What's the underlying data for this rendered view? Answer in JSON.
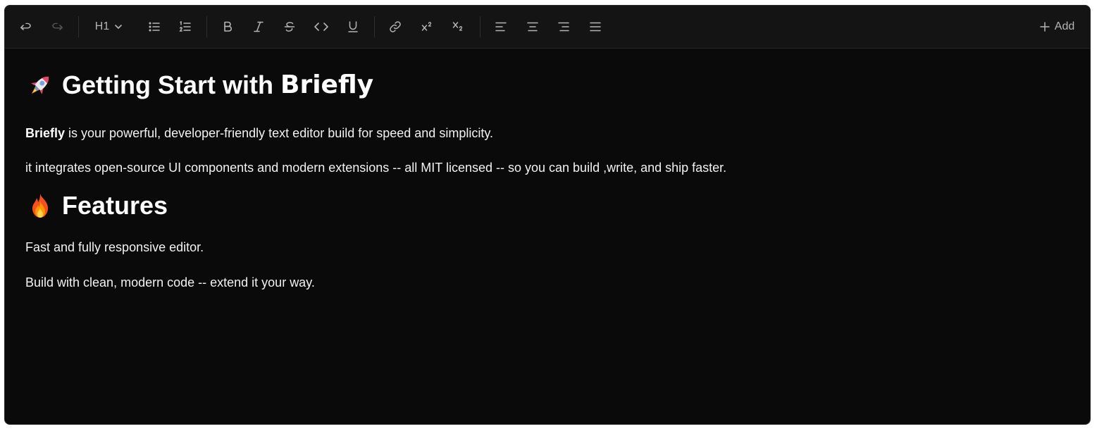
{
  "toolbar": {
    "buttons": [
      {
        "name": "undo-icon",
        "enabled": true
      },
      {
        "name": "redo-icon",
        "enabled": false
      },
      {
        "name": "bullet-list-icon"
      },
      {
        "name": "ordered-list-icon"
      },
      {
        "name": "bold-icon"
      },
      {
        "name": "italic-icon"
      },
      {
        "name": "strikethrough-icon"
      },
      {
        "name": "code-icon"
      },
      {
        "name": "underline-icon"
      },
      {
        "name": "link-icon"
      },
      {
        "name": "superscript-icon"
      },
      {
        "name": "subscript-icon"
      },
      {
        "name": "align-left-icon"
      },
      {
        "name": "align-center-icon"
      },
      {
        "name": "align-right-icon"
      },
      {
        "name": "align-justify-icon"
      }
    ],
    "heading_label": "H1",
    "add_label": "Add"
  },
  "document": {
    "heading1": {
      "emoji": "rocket-emoji",
      "text": "Getting Start with",
      "brand": "Briefly"
    },
    "para1": {
      "bold": "Briefly",
      "rest": " is your powerful, developer-friendly text editor build for speed and simplicity."
    },
    "para2": "it integrates open-source UI components and modern extensions -- all MIT licensed -- so you can build ,write, and ship faster.",
    "heading2": {
      "emoji": "fire-emoji",
      "text": "Features"
    },
    "para3": "Fast and fully responsive editor.",
    "para4": "Build with clean, modern code -- extend it your way."
  },
  "colors": {
    "editor_bg": "#0a0a0a",
    "toolbar_bg": "#141414",
    "icon": "#b5b5b5",
    "text": "#ffffff"
  }
}
